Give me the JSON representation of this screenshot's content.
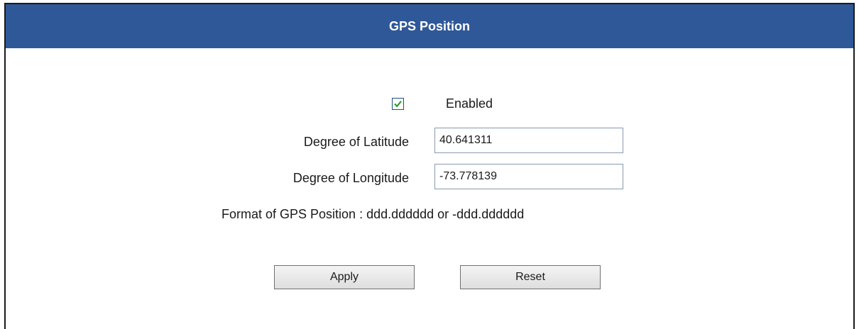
{
  "header": {
    "title": "GPS Position"
  },
  "enabled": {
    "label": "Enabled",
    "checked": true
  },
  "latitude": {
    "label": "Degree of Latitude",
    "value": "40.641311"
  },
  "longitude": {
    "label": "Degree of Longitude",
    "value": "-73.778139"
  },
  "format_hint": "Format of GPS Position : ddd.dddddd or -ddd.dddddd",
  "buttons": {
    "apply": "Apply",
    "reset": "Reset"
  },
  "colors": {
    "header_bg": "#2f5898",
    "checkmark": "#2e9e2e"
  }
}
